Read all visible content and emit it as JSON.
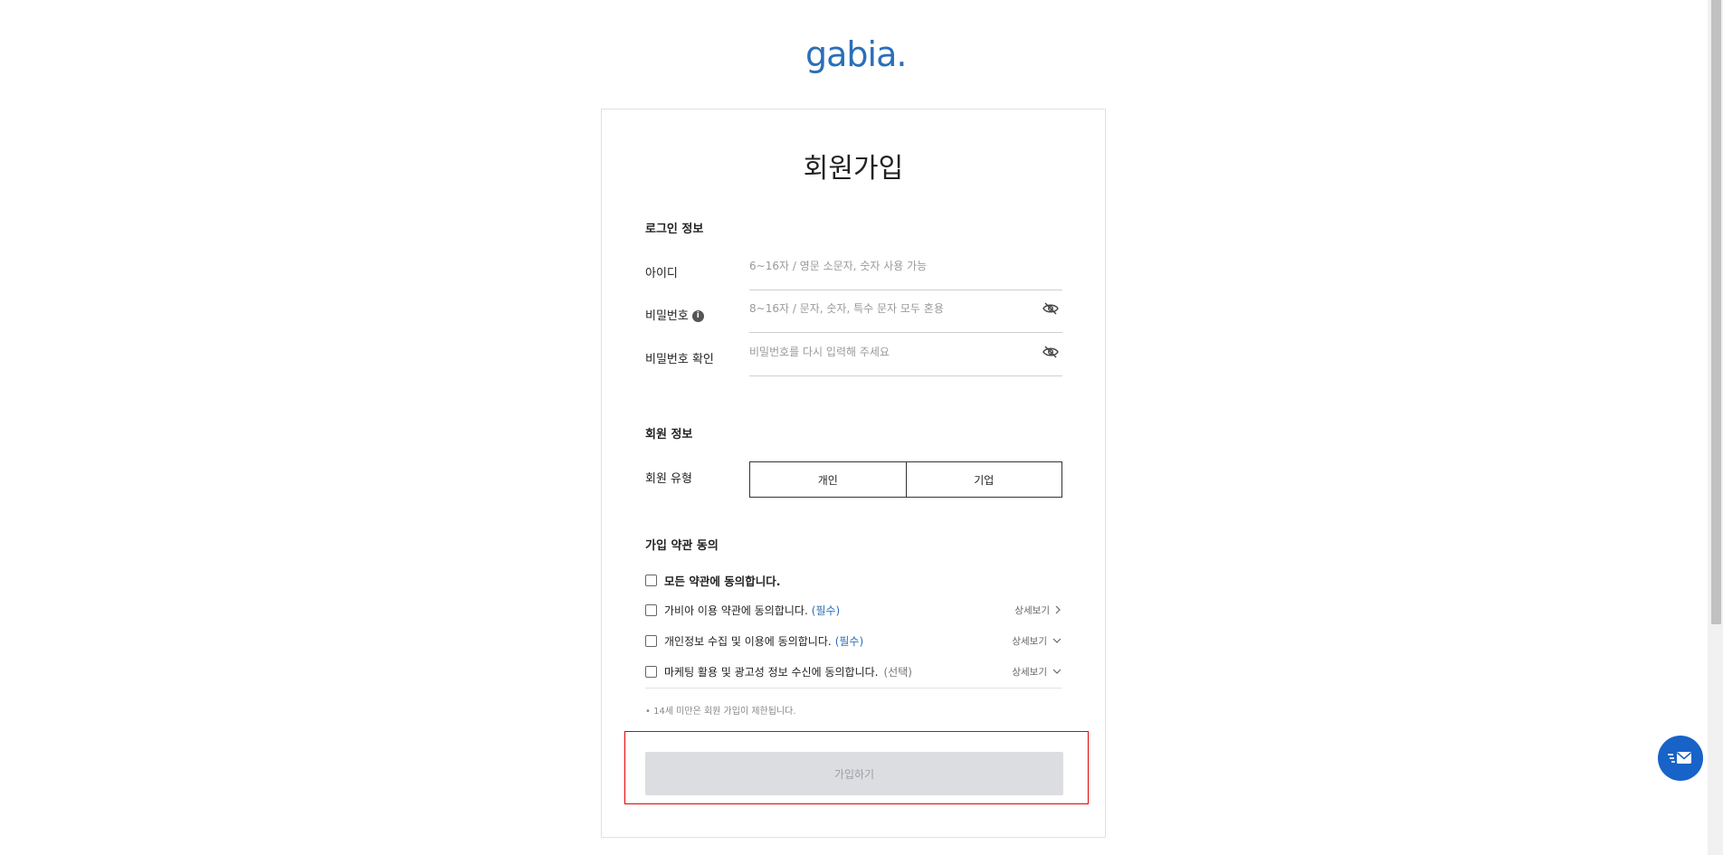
{
  "logo": {
    "text": "gabia",
    "dot": "."
  },
  "card": {
    "title": "회원가입",
    "login_section": {
      "title": "로그인 정보",
      "id_label": "아이디",
      "id_placeholder": "6~16자 / 영문 소문자, 숫자 사용 가능",
      "password_label": "비밀번호",
      "password_placeholder": "8~16자 / 문자, 숫자, 특수 문자 모두 혼용",
      "password_confirm_label": "비밀번호 확인",
      "password_confirm_placeholder": "비밀번호를 다시 입력해 주세요"
    },
    "member_section": {
      "title": "회원 정보",
      "type_label": "회원 유형",
      "type_options": [
        "개인",
        "기업"
      ]
    },
    "terms_section": {
      "title": "가입 약관 동의",
      "agree_all": "모든 약관에 동의합니다.",
      "items": [
        {
          "text": "가비아 이용 약관에 동의합니다.",
          "tag": "(필수)",
          "detail": "상세보기"
        },
        {
          "text": "개인정보 수집 및 이용에 동의합니다.",
          "tag": "(필수)",
          "detail": "상세보기"
        },
        {
          "text": "마케팅 활용 및 광고성 정보 수신에 동의합니다.",
          "tag": "(선택)",
          "detail": "상세보기"
        }
      ],
      "notice": "• 14세 미만은 회원 가입이 제한됩니다."
    },
    "submit_label": "가입하기"
  },
  "colors": {
    "brand": "#2a6fb8",
    "fab": "#1763c7",
    "highlight": "#e30000",
    "submit_bg": "#dcdde0"
  }
}
